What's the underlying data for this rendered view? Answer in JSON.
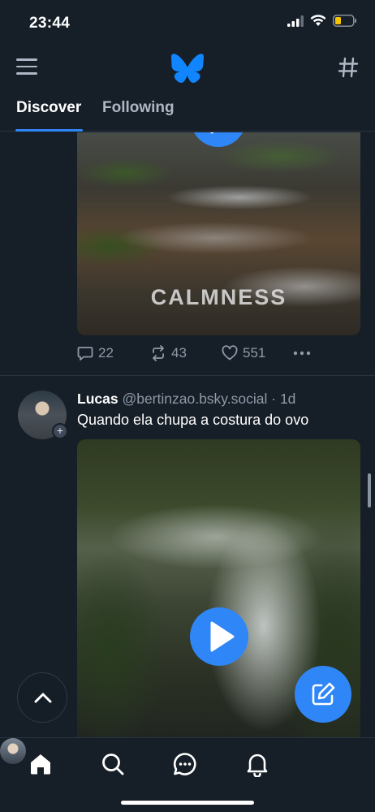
{
  "status_bar": {
    "time": "23:44",
    "signal_icon": "cellular-signal-icon",
    "wifi_icon": "wifi-icon",
    "battery_icon": "battery-low-icon",
    "battery_color": "#f5c400"
  },
  "top_bar": {
    "menu_icon": "menu-icon",
    "logo_icon": "butterfly-logo-icon",
    "feeds_icon": "hashtag-icon"
  },
  "tabs": [
    {
      "label": "Discover",
      "active": true
    },
    {
      "label": "Following",
      "active": false
    }
  ],
  "posts": [
    {
      "media_caption": "CALMNESS",
      "replies": "22",
      "reposts": "43",
      "likes": "551",
      "more_icon": "more-dots-icon"
    },
    {
      "author_name": "Lucas",
      "author_handle": "@bertinzao.bsky.social",
      "separator": "·",
      "time_ago": "1d",
      "text": "Quando ela chupa a costura do ovo",
      "media_icon": "play-icon"
    }
  ],
  "floating": {
    "scroll_top_icon": "chevron-up-icon",
    "compose_icon": "compose-icon"
  },
  "bottom_nav": {
    "items": [
      "home-icon",
      "search-icon",
      "chat-icon",
      "bell-icon",
      "profile-avatar"
    ]
  },
  "colors": {
    "background": "#161e27",
    "accent": "#2f86f6",
    "muted_text": "#8f9aa8"
  }
}
